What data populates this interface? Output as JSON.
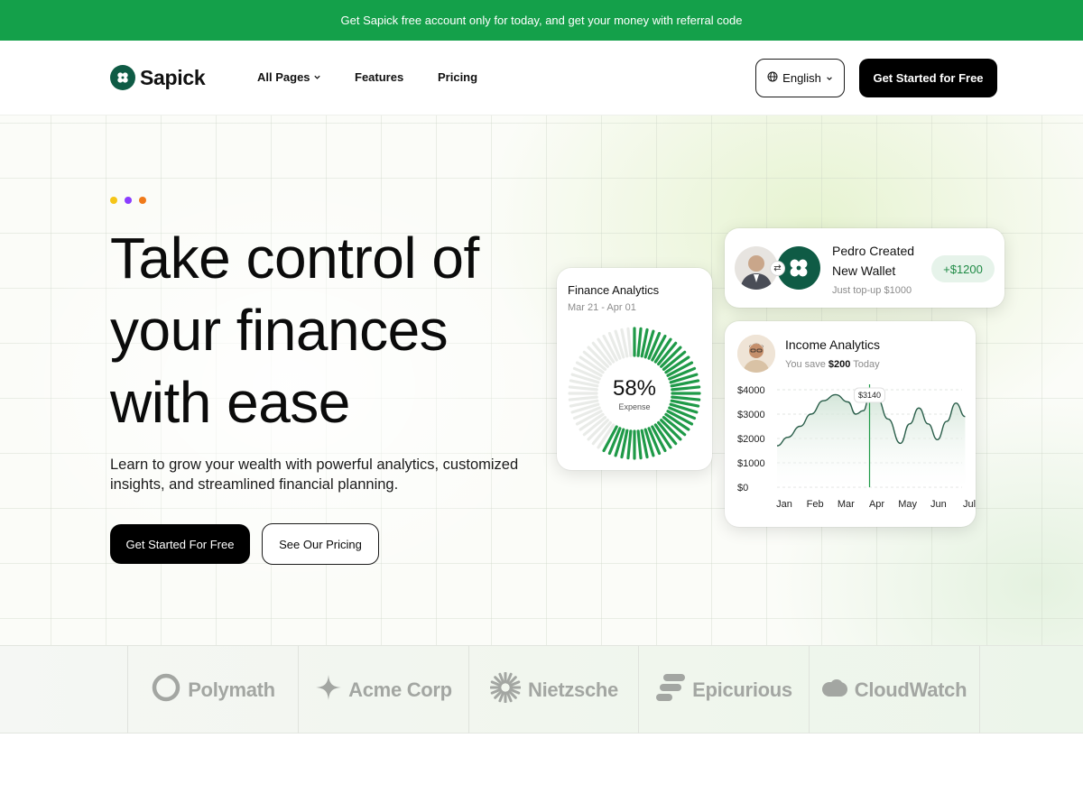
{
  "announcement": "Get Sapick free account only for today, and get your money with referral code",
  "brand": {
    "name": "Sapick",
    "logo_icon": "clover-icon",
    "color": "#0f5b45"
  },
  "nav": {
    "items": [
      {
        "label": "All Pages",
        "has_dropdown": true
      },
      {
        "label": "Features"
      },
      {
        "label": "Pricing"
      }
    ],
    "language": "English",
    "cta": "Get Started for Free"
  },
  "hero": {
    "dot_colors": [
      "#f5c518",
      "#8b3dff",
      "#f07a1a"
    ],
    "headline": [
      "Take control of",
      "your finances",
      "with ease"
    ],
    "subtitle": "Learn to grow your wealth with powerful analytics, customized insights, and streamlined financial planning.",
    "primary_cta": "Get Started For Free",
    "secondary_cta": "See Our Pricing"
  },
  "finance_card": {
    "title": "Finance Analytics",
    "range": "Mar 21 - Apr 01",
    "percent_value": 0.58,
    "percent_label": "58%",
    "caption": "Expense",
    "accent": "#1f9a48"
  },
  "wallet_card": {
    "title": "Pedro Created New Wallet",
    "subtitle": "Just top-up $1000",
    "amount": "+$1200",
    "swap_icon": "swap-arrows-icon"
  },
  "income_card": {
    "title": "Income Analytics",
    "subtitle_prefix": "You save",
    "subtitle_amount": "$200",
    "subtitle_suffix": "Today",
    "tooltip": "$3140"
  },
  "chart_data": {
    "type": "area",
    "categories": [
      "Jan",
      "Feb",
      "Mar",
      "Apr",
      "May",
      "Jun",
      "Jul"
    ],
    "y_tick_labels": [
      "$4000",
      "$3000",
      "$2000",
      "$1000",
      "$0"
    ],
    "ylim": [
      0,
      4000
    ],
    "series": [
      {
        "x": [
          0,
          0.35,
          0.75,
          1.1,
          1.5,
          1.9,
          2.3,
          2.55,
          2.8,
          3.0,
          3.25,
          3.6,
          4.0,
          4.3,
          4.6,
          4.9,
          5.2,
          5.5,
          5.8,
          6.1
        ],
        "values": [
          1700,
          2050,
          2500,
          3000,
          3550,
          3800,
          3500,
          3000,
          3140,
          3750,
          3650,
          2800,
          1800,
          2600,
          3250,
          2600,
          1950,
          2700,
          3450,
          2900
        ]
      }
    ],
    "highlight": {
      "x": 3.0,
      "label": "$3140"
    },
    "grid": true,
    "line_color": "#2a5e4a"
  },
  "partners": [
    {
      "name": "Polymath",
      "icon": "ring-icon"
    },
    {
      "name": "Acme Corp",
      "icon": "sparkle-icon"
    },
    {
      "name": "Nietzsche",
      "icon": "sunburst-icon"
    },
    {
      "name": "Epicurious",
      "icon": "stacked-bars-icon"
    },
    {
      "name": "CloudWatch",
      "icon": "cloud-icon"
    }
  ]
}
